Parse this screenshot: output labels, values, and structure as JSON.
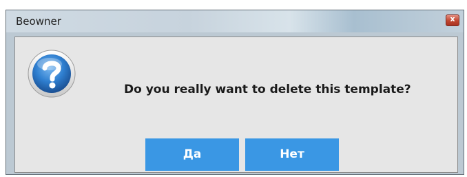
{
  "window": {
    "title": "Beowner",
    "close_glyph": "x"
  },
  "dialog": {
    "icon": "question-icon",
    "message": "Do you really want to delete this template?",
    "yes_label": "Да",
    "no_label": "Нет"
  },
  "colors": {
    "button": "#3a97e4",
    "button_text": "#ffffff",
    "client_bg": "#e6e6e6",
    "frame": "#bcc9d3",
    "close_button": "#c0452f"
  }
}
